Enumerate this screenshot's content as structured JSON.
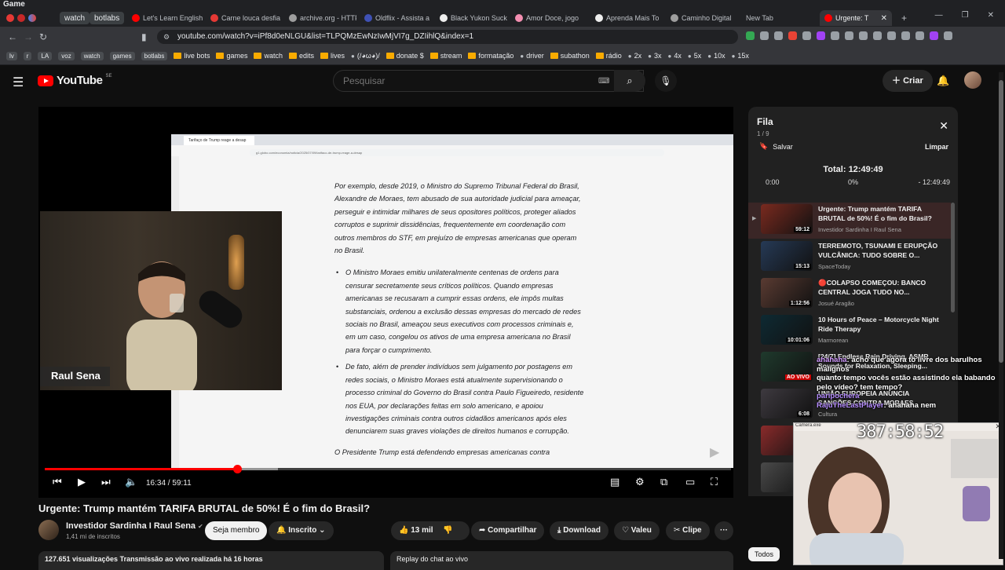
{
  "os": {
    "title": "Game"
  },
  "browser": {
    "pinned_tabs": [
      "watch",
      "botlabs"
    ],
    "tabs": [
      "Let's Learn English",
      "Carne louca desfia",
      "archive.org - HTTP",
      "Oldflix - Assista a",
      "Black Yukon Suck",
      "Amor Doce, jogo",
      "Aprenda Mais To",
      "Caminho Digital",
      "New Tab",
      "Urgente: T"
    ],
    "active_tab_close": "✕",
    "new_tab": "+",
    "url": "youtube.com/watch?v=iPf8d0eNLGU&list=TLPQMzEwNzIwMjVI7g_DZIihlQ&index=1",
    "bookmarks": [
      {
        "label": "lv",
        "type": "chip"
      },
      {
        "label": "r",
        "type": "chip"
      },
      {
        "label": "LA",
        "type": "chip"
      },
      {
        "label": "voz",
        "type": "chip"
      },
      {
        "label": "watch",
        "type": "chip"
      },
      {
        "label": "games",
        "type": "chip"
      },
      {
        "label": "botlabs",
        "type": "chip"
      },
      {
        "label": "live bots",
        "type": "folder"
      },
      {
        "label": "games",
        "type": "folder"
      },
      {
        "label": "watch",
        "type": "folder"
      },
      {
        "label": "edits",
        "type": "folder"
      },
      {
        "label": "lives",
        "type": "folder"
      },
      {
        "label": "(/◕ω◕)/",
        "type": "link"
      },
      {
        "label": "donate $",
        "type": "folder"
      },
      {
        "label": "stream",
        "type": "folder"
      },
      {
        "label": "formatação",
        "type": "folder"
      },
      {
        "label": "driver",
        "type": "link"
      },
      {
        "label": "subathon",
        "type": "folder"
      },
      {
        "label": "rádio",
        "type": "folder"
      },
      {
        "label": "2x",
        "type": "link"
      },
      {
        "label": "3x",
        "type": "link"
      },
      {
        "label": "4x",
        "type": "link"
      },
      {
        "label": "5x",
        "type": "link"
      },
      {
        "label": "10x",
        "type": "link"
      },
      {
        "label": "15x",
        "type": "link"
      }
    ],
    "ext_colors": [
      "#34a853",
      "#9aa0a6",
      "#9aa0a6",
      "#ea4335",
      "#9aa0a6",
      "#a142f4",
      "#9aa0a6",
      "#9aa0a6",
      "#9aa0a6",
      "#9aa0a6",
      "#9aa0a6",
      "#9aa0a6",
      "#9aa0a6",
      "#a142f4",
      "#9aa0a6"
    ]
  },
  "yt": {
    "logo": "YouTube",
    "country": "SE",
    "search_placeholder": "Pesquisar",
    "create_label": "Criar"
  },
  "video": {
    "title": "Urgente: Trump mantém TARIFA BRUTAL de 50%! É o fim do Brasil?",
    "current_time": "16:34",
    "duration": "59:11",
    "progress": 0.28,
    "time_display": "16:34 / 59:11",
    "host_name": "Raul Sena",
    "screen_tab": "Tarifaço de Trump reage a desap",
    "screen_url": "g1.globo.com/economia/noticia/2025/07/09/tarifaco-de-trump-reage-a-desap",
    "screen_text": {
      "p1": "Por exemplo, desde 2019, o Ministro do Supremo Tribunal Federal do Brasil, Alexandre de Moraes, tem abusado de sua autoridade judicial para ameaçar, perseguir e intimidar milhares de seus opositores políticos, proteger aliados corruptos e suprimir dissidências, frequentemente em coordenação com outros membros do STF, em prejuízo de empresas americanas que operam no Brasil.",
      "b1": "O Ministro Moraes emitiu unilateralmente centenas de ordens para censurar secretamente seus críticos políticos. Quando empresas americanas se recusaram a cumprir essas ordens, ele impôs multas substanciais, ordenou a exclusão dessas empresas do mercado de redes sociais no Brasil, ameaçou seus executivos com processos criminais e, em um caso, congelou os ativos de uma empresa americana no Brasil para forçar o cumprimento.",
      "b2": "De fato, além de prender indivíduos sem julgamento por postagens em redes sociais, o Ministro Moraes está atualmente supervisionando o processo criminal do Governo do Brasil contra Paulo Figueiredo, residente nos EUA, por declarações feitas em solo americano, e apoiou investigações criminais contra outros cidadãos americanos após eles denunciarem suas graves violações de direitos humanos e corrupção.",
      "p2": "O Presidente Trump está defendendo empresas americanas contra"
    }
  },
  "channel": {
    "name": "Investidor Sardinha I Raul Sena",
    "subs": "1,41 mi de inscritos",
    "join": "Seja membro",
    "subscribed": "Inscrito"
  },
  "actions": {
    "likes": "13 mil",
    "share": "Compartilhar",
    "download": "Download",
    "thanks": "Valeu",
    "clip": "Clipe",
    "more": "···"
  },
  "description": {
    "views": "127.651 visualizações",
    "stream_info": "Transmissão ao vivo realizada há 16 horas"
  },
  "chat_replay": "Replay do chat ao vivo",
  "queue": {
    "title": "Fila",
    "position": "1 / 9",
    "save": "Salvar",
    "clear": "Limpar",
    "total": "Total: 12:49:49",
    "start": "0:00",
    "percent": "0%",
    "end": "- 12:49:49",
    "items": [
      {
        "title": "Urgente: Trump mantém TARIFA BRUTAL de 50%! É o fim do Brasil?",
        "channel": "Investidor Sardinha I Raul Sena",
        "duration": "59:12",
        "current": true,
        "thumb": "#7a2a1f"
      },
      {
        "title": "TERREMOTO, TSUNAMI E ERUPÇÃO VULCÂNICA: TUDO SOBRE O...",
        "channel": "SpaceToday",
        "duration": "15:13",
        "current": false,
        "thumb": "#263a56"
      },
      {
        "title": "🔴COLAPSO COMEÇOU: BANCO CENTRAL JOGA TUDO NO...",
        "channel": "Josué Aragão",
        "duration": "1:12:56",
        "current": false,
        "thumb": "#5a3b32"
      },
      {
        "title": "10 Hours of Peace – Motorcycle Night Ride Therapy",
        "channel": "Marmorean",
        "duration": "10:01:06",
        "current": false,
        "thumb": "#0e2a33"
      },
      {
        "title": "[24/7] Endless Rain Driving, ASMR Sounds for Relaxation, Sleeping...",
        "channel": "Hello Korea",
        "duration": "AO VIVO",
        "current": false,
        "thumb": "#1f3a2d"
      },
      {
        "title": "UNIÃO EUROPEIA ANUNCIA SANÇÕES CONTRA MORAES",
        "channel": "Cultura",
        "duration": "6:08",
        "current": false,
        "thumb": "#3e3a40"
      },
      {
        "title": "",
        "channel": "",
        "duration": "",
        "current": false,
        "thumb": "#8a2b2b"
      },
      {
        "title": "",
        "channel": "",
        "duration": "",
        "current": false,
        "thumb": "#4a4a4a"
      }
    ]
  },
  "chat_overlay": [
    {
      "user": "ahahaha",
      "text": "acho que agora tô livre dos barulhos malignos"
    },
    {
      "user": "",
      "text": "quanto tempo vocês estão assistindo ela babando pelo vídeo? tem tempo?"
    },
    {
      "user": "paripochera",
      "text": ""
    },
    {
      "user": "RajuTheLastPlayer",
      "text": "ahahaha nem"
    }
  ],
  "streamer_cam": {
    "title": "Camera.exe",
    "timer": "387:58:52",
    "close": "✕"
  },
  "filter_chip": "Todos"
}
